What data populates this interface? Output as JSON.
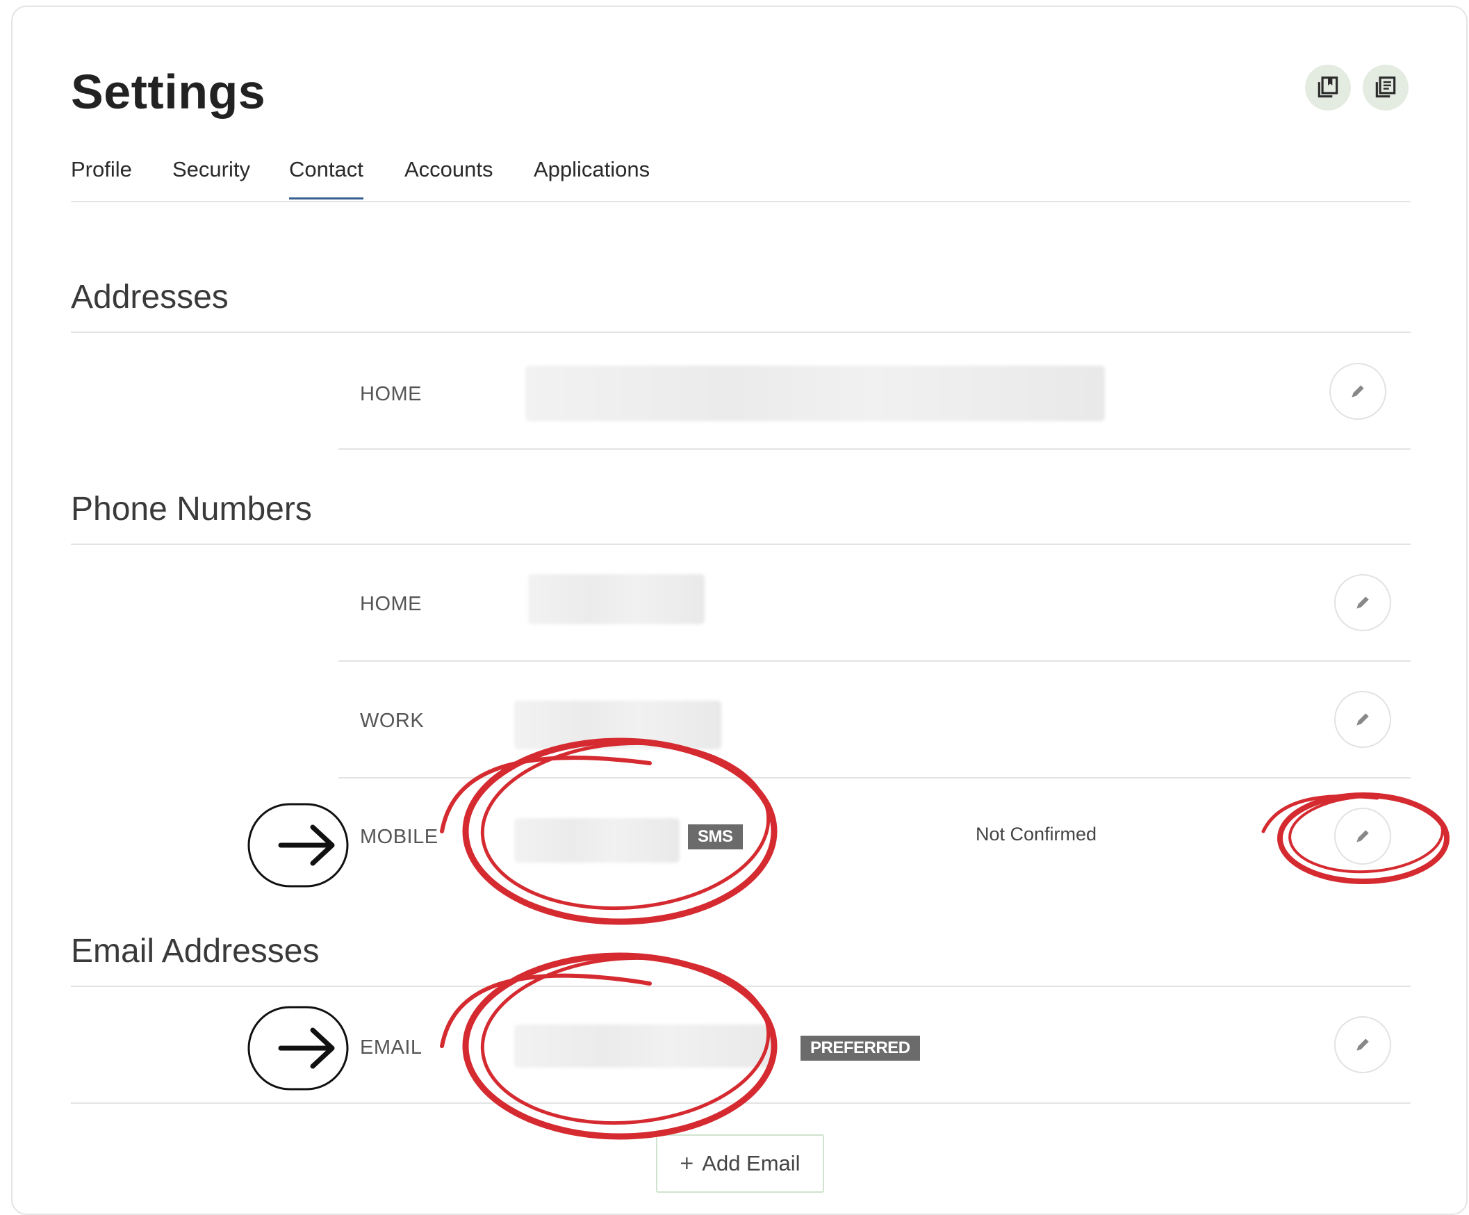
{
  "header": {
    "title": "Settings"
  },
  "tabs": [
    {
      "label": "Profile"
    },
    {
      "label": "Security"
    },
    {
      "label": "Contact",
      "active": true
    },
    {
      "label": "Accounts"
    },
    {
      "label": "Applications"
    }
  ],
  "sections": {
    "addresses": {
      "title": "Addresses",
      "rows": [
        {
          "label": "HOME"
        }
      ]
    },
    "phones": {
      "title": "Phone Numbers",
      "rows": [
        {
          "label": "HOME"
        },
        {
          "label": "WORK"
        },
        {
          "label": "MOBILE",
          "badge": "SMS",
          "status": "Not Confirmed"
        }
      ]
    },
    "emails": {
      "title": "Email Addresses",
      "rows": [
        {
          "label": "EMAIL",
          "badge": "PREFERRED"
        }
      ],
      "add_label": "Add Email"
    }
  },
  "icons": {
    "toolbar_left": "bookmark-pages-icon",
    "toolbar_right": "document-list-icon",
    "edit": "pencil-icon",
    "add": "plus-icon",
    "annotation_arrow": "arrow-right-icon"
  },
  "colors": {
    "accent": "#3b5f91",
    "annotation_red": "#d42a30",
    "icon_button_bg": "#e4ece2",
    "badge_bg": "#6b6b6b"
  }
}
